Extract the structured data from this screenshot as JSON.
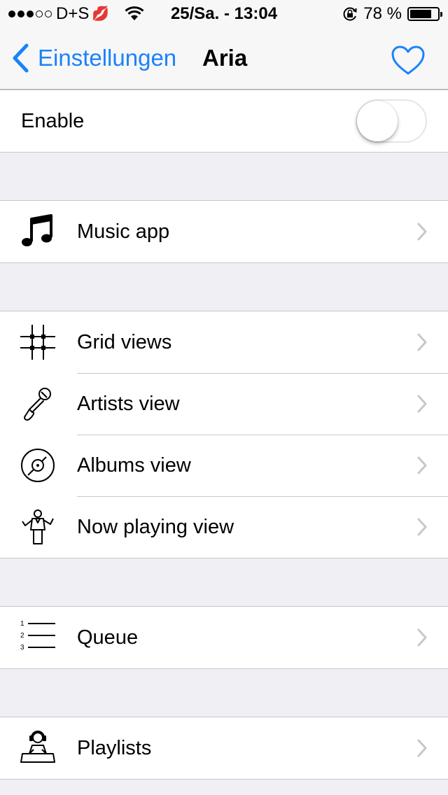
{
  "status_bar": {
    "carrier": "D+S",
    "emoji": "💋",
    "datetime": "25/Sa. - 13:04",
    "battery_percent": "78 %",
    "battery_level": 0.78,
    "signal_bars_filled": 3,
    "signal_bars_total": 5
  },
  "nav": {
    "back_label": "Einstellungen",
    "title": "Aria",
    "heart_icon": "heart-outline-icon"
  },
  "enable": {
    "label": "Enable",
    "on": false
  },
  "items": {
    "music_app": {
      "label": "Music app",
      "icon": "music-note-icon"
    },
    "grid_views": {
      "label": "Grid views",
      "icon": "grid-icon"
    },
    "artists_view": {
      "label": "Artists view",
      "icon": "microphone-icon"
    },
    "albums_view": {
      "label": "Albums view",
      "icon": "vinyl-record-icon"
    },
    "now_playing_view": {
      "label": "Now playing view",
      "icon": "conductor-icon"
    },
    "queue": {
      "label": "Queue",
      "icon": "numbered-list-icon"
    },
    "playlists": {
      "label": "Playlists",
      "icon": "dj-icon"
    }
  },
  "colors": {
    "accent": "#1a82fb",
    "background": "#efeff4",
    "separator": "#c8c7cc",
    "chevron": "#c7c7cc"
  }
}
